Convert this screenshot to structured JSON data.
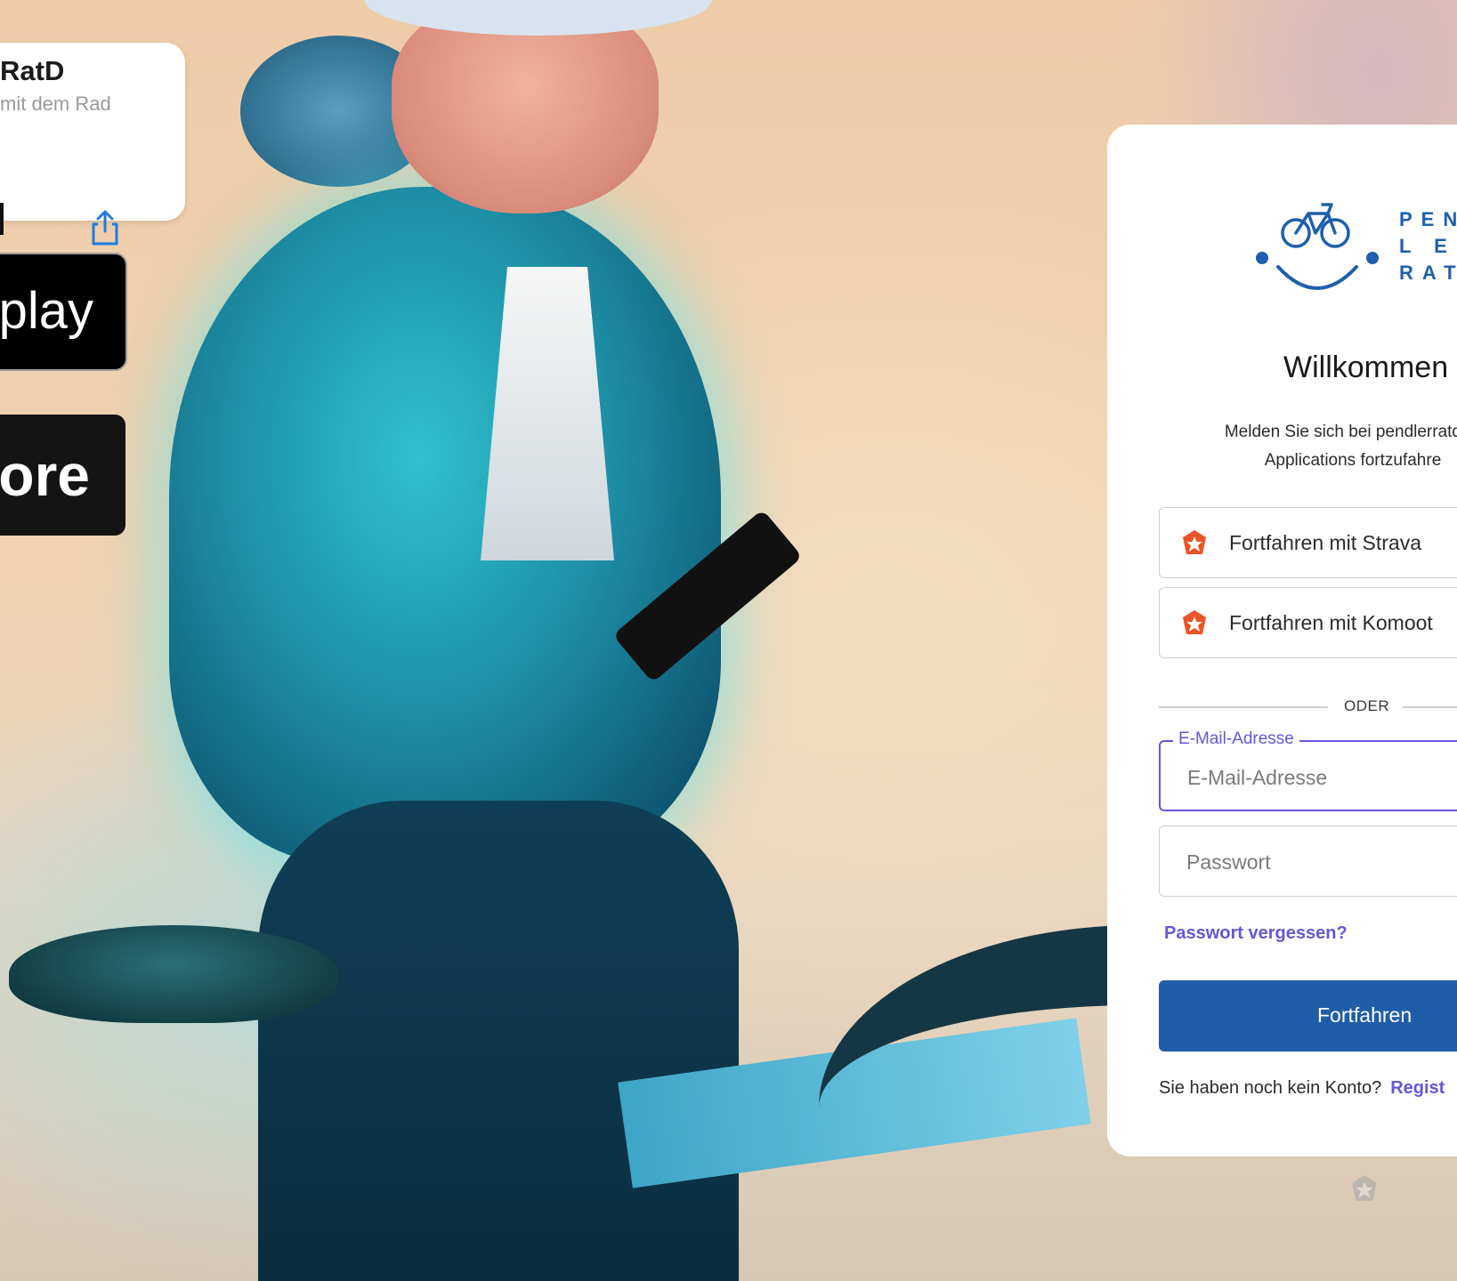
{
  "app_card": {
    "name": "RatD",
    "subtitle": "mit dem Rad"
  },
  "store_badges": {
    "google_play_fragment": "play",
    "app_store_fragment": "tore"
  },
  "login": {
    "brand_lines": [
      "PEN",
      "L E",
      "RAT"
    ],
    "title": "Willkommen",
    "description_lines": [
      "Melden Sie sich bei pendlerratd ar",
      "Applications fortzufahre"
    ],
    "sso_buttons": [
      {
        "label": "Fortfahren mit Strava",
        "icon": "auth0-star-icon"
      },
      {
        "label": "Fortfahren mit Komoot",
        "icon": "auth0-star-icon"
      }
    ],
    "divider_text": "ODER",
    "email": {
      "floating_label": "E-Mail-Adresse",
      "placeholder": "E-Mail-Adresse",
      "value": ""
    },
    "password": {
      "placeholder": "Passwort",
      "value": ""
    },
    "forgot_password": "Passwort vergessen?",
    "submit_label": "Fortfahren",
    "signup_prompt": "Sie haben noch kein Konto?",
    "signup_link": "Regist"
  },
  "colors": {
    "brand_blue": "#1f5da8",
    "accent_purple": "#6556d8",
    "auth0_orange": "#eb5424"
  }
}
